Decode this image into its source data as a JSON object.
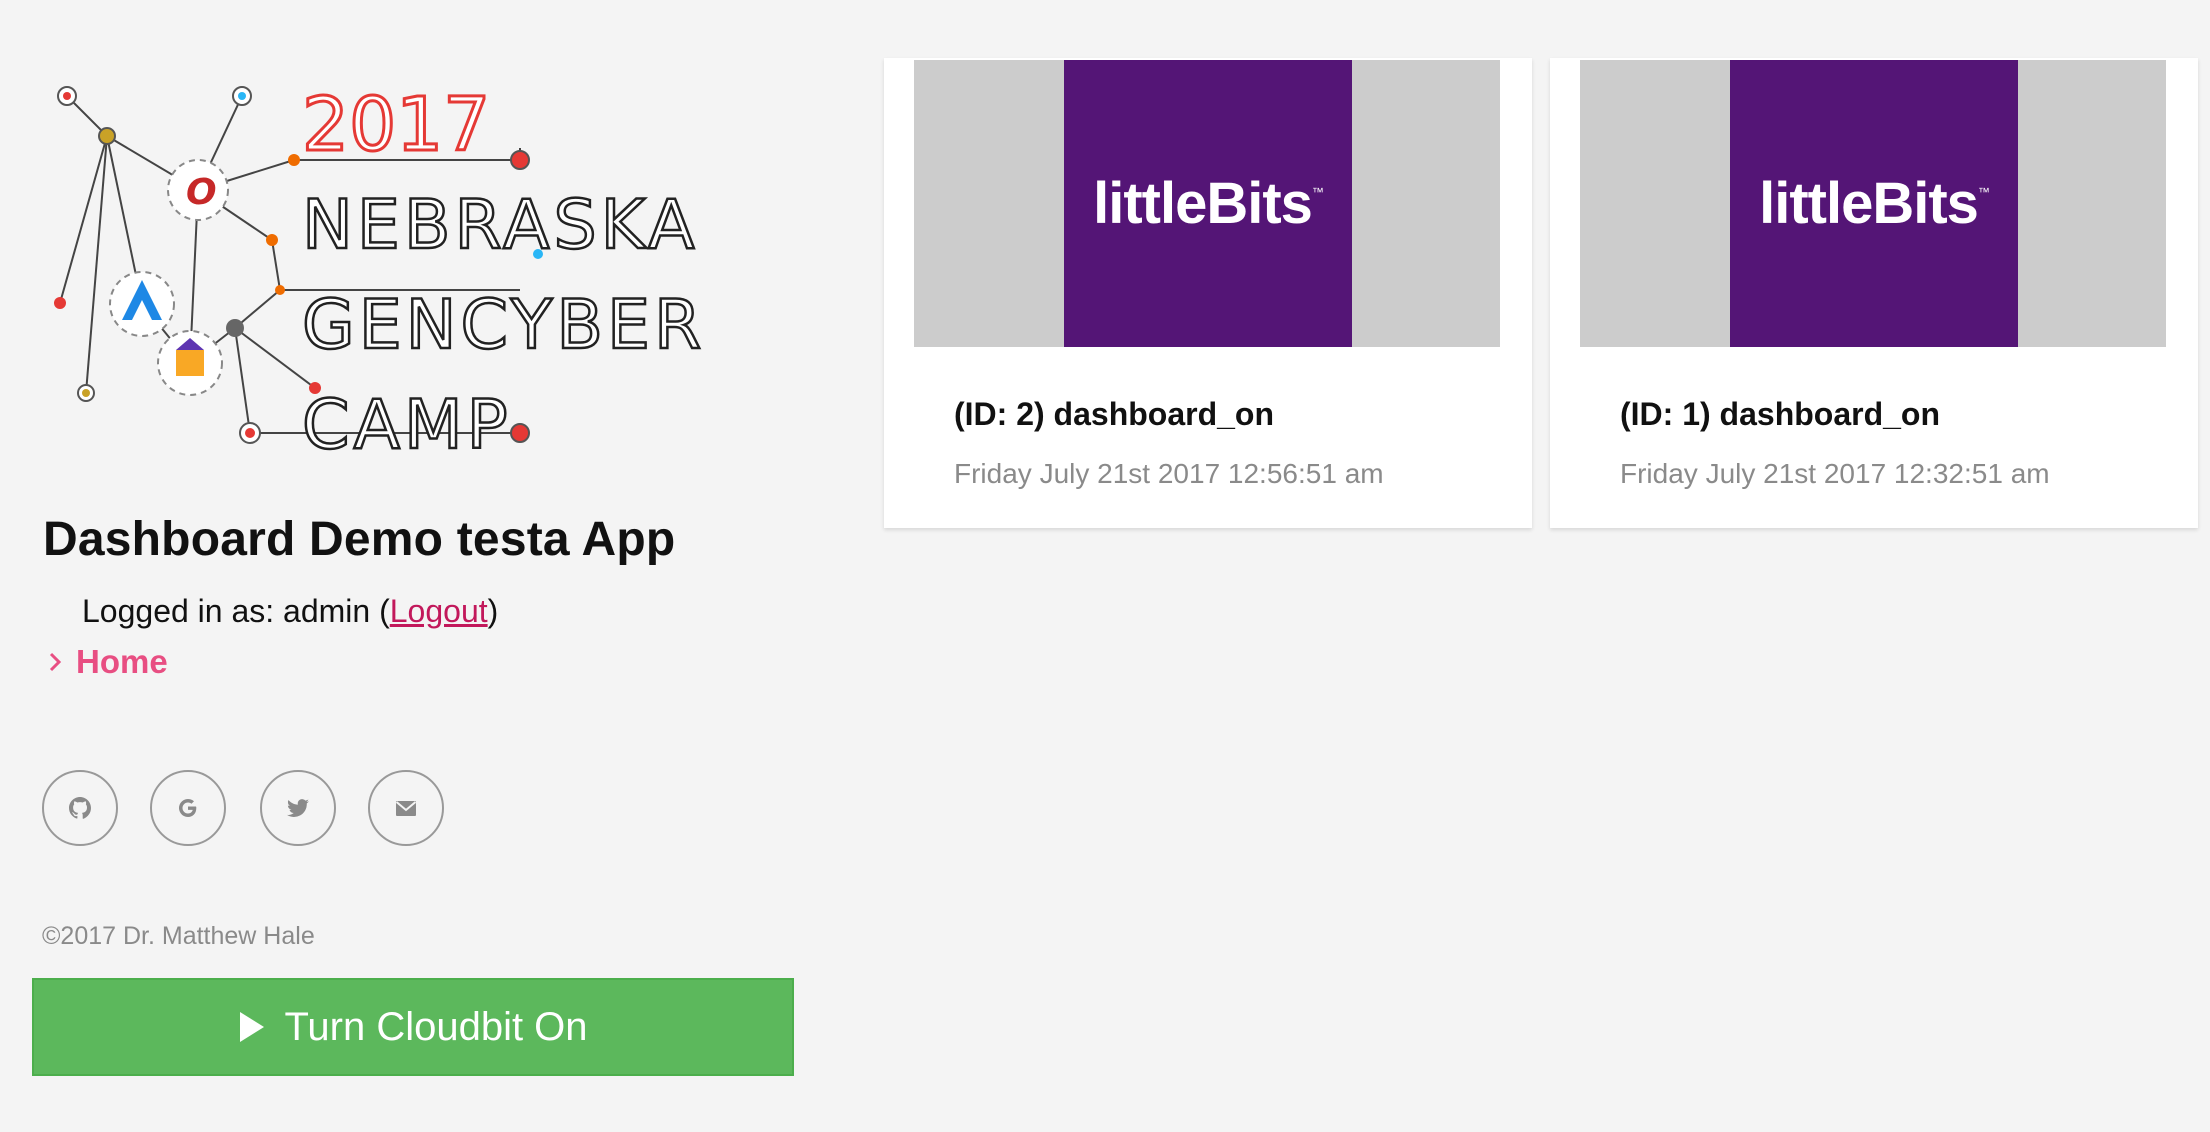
{
  "logo": {
    "year": "2017",
    "line1": "NEBRASKA",
    "line2": "GENCYBER",
    "line3": "CAMP"
  },
  "sidebar": {
    "app_title": "Dashboard Demo testa App",
    "login_prefix": "Logged in as: admin (",
    "logout_label": "Logout",
    "login_suffix": ")",
    "nav": [
      {
        "label": "Home",
        "icon": "chevron-right-icon"
      }
    ],
    "social": [
      {
        "icon": "github-icon"
      },
      {
        "icon": "google-icon"
      },
      {
        "icon": "twitter-icon"
      },
      {
        "icon": "mail-icon"
      }
    ],
    "copyright": "©2017 Dr. Matthew Hale",
    "cta_label": "Turn Cloudbit On"
  },
  "cards": [
    {
      "brand": "littleBits",
      "title": "(ID: 2) dashboard_on",
      "time": "Friday July 21st 2017 12:56:51 am"
    },
    {
      "brand": "littleBits",
      "title": "(ID: 1) dashboard_on",
      "time": "Friday July 21st 2017 12:32:51 am"
    }
  ],
  "colors": {
    "accent": "#e84e82",
    "logout_link": "#c2185b",
    "cta": "#5cb85c",
    "brand_purple": "#541576",
    "logo_red": "#e53935"
  }
}
